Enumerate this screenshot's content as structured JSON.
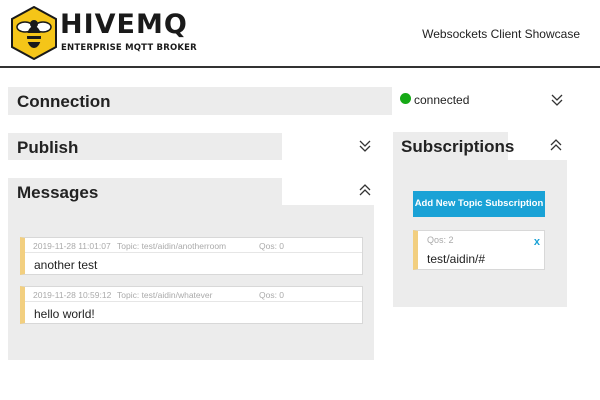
{
  "header": {
    "brand": "HIVEMQ",
    "tagline": "ENTERPRISE MQTT BROKER",
    "app_title": "Websockets Client Showcase"
  },
  "connection": {
    "title": "Connection",
    "status": "connected",
    "status_color": "#16a916",
    "toggle_icon": "chevron-double-down"
  },
  "publish": {
    "title": "Publish",
    "toggle_icon": "chevron-double-down"
  },
  "messages": {
    "title": "Messages",
    "toggle_icon": "chevron-double-up",
    "items": [
      {
        "timestamp": "2019-11-28 11:01:07",
        "topic": "Topic: test/aidin/anotherroom",
        "qos": "Qos: 0",
        "payload": "another test"
      },
      {
        "timestamp": "2019-11-28 10:59:12",
        "topic": "Topic: test/aidin/whatever",
        "qos": "Qos: 0",
        "payload": "hello world!"
      }
    ]
  },
  "subscriptions": {
    "title": "Subscriptions",
    "toggle_icon": "chevron-double-up",
    "add_button": "Add New Topic Subscription",
    "items": [
      {
        "qos": "Qos: 2",
        "topic": "test/aidin/#",
        "remove_label": "x"
      }
    ]
  },
  "colors": {
    "accent": "#1aa2d6",
    "panel_bg": "#ececec",
    "card_stripe": "#f2cf80",
    "brand_yellow": "#f5c518"
  }
}
